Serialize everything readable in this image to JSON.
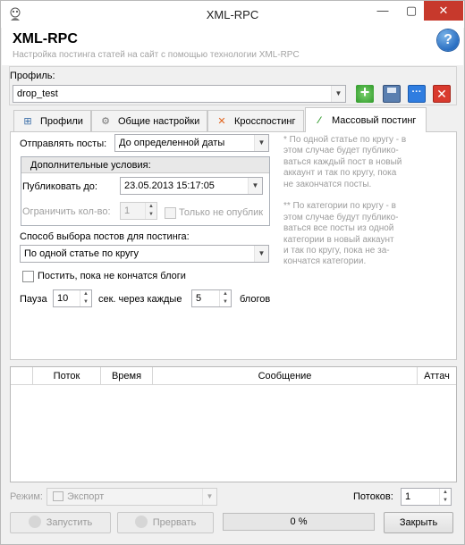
{
  "window": {
    "title": "XML-RPC",
    "minimize": "—",
    "maximize": "▢",
    "close": "✕"
  },
  "header": {
    "title": "XML-RPC",
    "subtitle": "Настройка постинга статей на сайт с помощью технологии XML-RPC",
    "help": "?"
  },
  "profile": {
    "label": "Профиль:",
    "value": "drop_test"
  },
  "tabs": [
    {
      "label": "Профили",
      "icon": "sitemap-icon",
      "active": false
    },
    {
      "label": "Общие настройки",
      "icon": "gear-icon",
      "active": false
    },
    {
      "label": "Кросспостинг",
      "icon": "cross-arrows-icon",
      "active": false
    },
    {
      "label": "Массовый постинг",
      "icon": "magic-wand-icon",
      "active": true
    }
  ],
  "mass_posting": {
    "send_posts_label": "Отправлять посты:",
    "send_posts_value": "До определенной даты",
    "extra_conditions_title": "Дополнительные условия:",
    "publish_until_label": "Публиковать до:",
    "publish_until_value": "23.05.2013 15:17:05",
    "limit_label": "Ограничить кол-во:",
    "limit_value": "1",
    "only_unpublished_label": "Только не опублик",
    "selection_method_label": "Способ выбора постов для постинга:",
    "selection_method_value": "По одной статье по кругу",
    "post_until_blogs_label": "Постить, пока не кончатся блоги",
    "pause_label": "Пауза",
    "pause_value": "10",
    "sec_every_label": "сек. через каждые",
    "blogs_count_value": "5",
    "blogs_label": "блогов",
    "note": "* По одной статье по кругу - в\nэтом случае будет публико-\nваться каждый пост в новый\nаккаунт и так по кругу, пока\nне закончатся посты.\n\n** По категории по кругу - в\nэтом случае будут публико-\nваться все посты из  одной\nкатегории в новый аккаунт\nи так по кругу, пока не за-\nкончатся категории."
  },
  "log": {
    "columns": [
      "",
      "Поток",
      "Время",
      "Сообщение",
      "Аттач"
    ]
  },
  "footer": {
    "mode_label": "Режим:",
    "mode_value": "Экспорт",
    "threads_label": "Потоков:",
    "threads_value": "1",
    "start_label": "Запустить",
    "stop_label": "Прервать",
    "progress_text": "0 %",
    "progress_fraction": 0,
    "close_label": "Закрыть"
  },
  "colors": {
    "accent": "#2a6fc2",
    "close": "#c7392c",
    "note": "#9c9c9c"
  }
}
